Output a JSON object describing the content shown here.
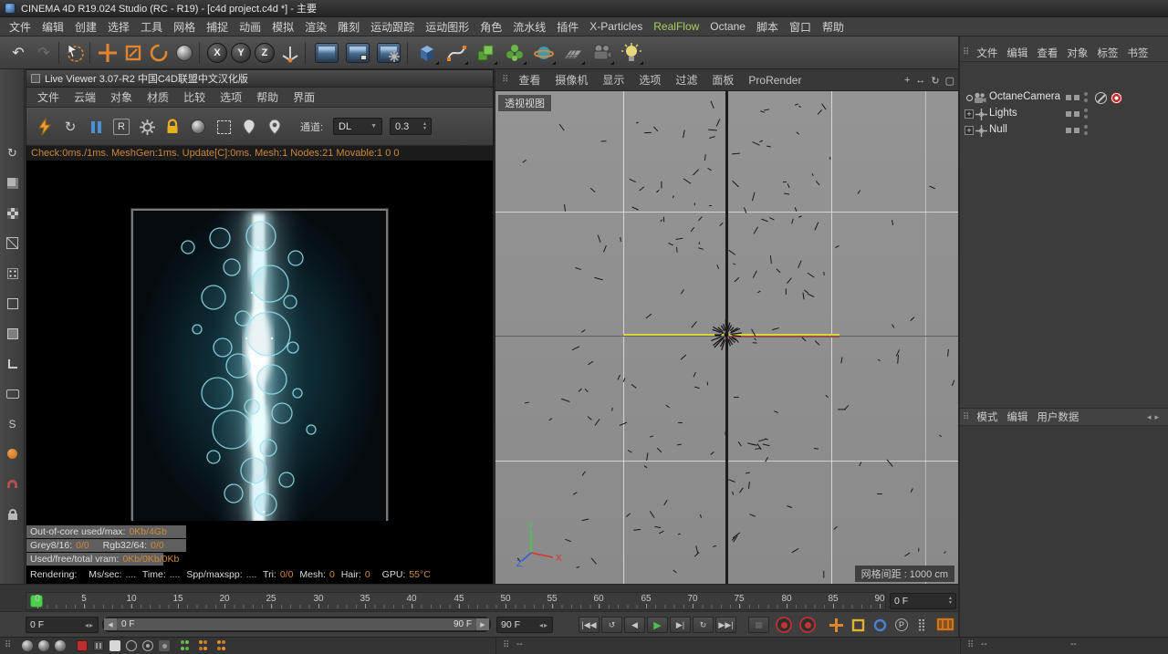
{
  "colors": {
    "accent_orange": "#e2862e",
    "octane_value_orange": "#cf8a3a",
    "realflow_green": "#a8d060",
    "play_green": "#4cc04c",
    "marker_green": "#4cd04c"
  },
  "titlebar": {
    "title": "CINEMA 4D R19.024 Studio (RC - R19) - [c4d project.c4d *] - 主要"
  },
  "menubar": {
    "items": [
      "文件",
      "编辑",
      "创建",
      "选择",
      "工具",
      "网格",
      "捕捉",
      "动画",
      "模拟",
      "渲染",
      "雕刻",
      "运动跟踪",
      "运动图形",
      "角色",
      "流水线",
      "插件",
      "X-Particles",
      "RealFlow",
      "Octane",
      "脚本",
      "窗口",
      "帮助"
    ]
  },
  "toolbar": {
    "axis_x": "X",
    "axis_y": "Y",
    "axis_z": "Z"
  },
  "left_toolbar": {
    "snap_label": "S"
  },
  "live_viewer": {
    "title": "Live Viewer 3.07-R2 中国C4D联盟中文汉化版",
    "menus": [
      "文件",
      "云端",
      "对象",
      "材质",
      "比较",
      "选项",
      "帮助",
      "界面"
    ],
    "r_button": "R",
    "channel_label": "通道:",
    "channel_value": "DL",
    "sample_value": "0.3",
    "status_line": "Check:0ms./1ms. MeshGen:1ms. Update[C]:0ms. Mesh:1 Nodes:21 Movable:1  0 0",
    "stats": {
      "outofcore_label": "Out-of-core used/max:",
      "outofcore_value": "0Kb/4Gb",
      "grey_label": "Grey8/16:",
      "grey_value": "0/0",
      "rgb_label": "Rgb32/64:",
      "rgb_value": "0/0",
      "vram_label": "Used/free/total vram:",
      "vram_value": "0Kb/0Kb/0Kb",
      "rendering_label": "Rendering:",
      "mssec_label": "Ms/sec:",
      "mssec_value": "....",
      "time_label": "Time:",
      "time_value": "....",
      "spp_label": "Spp/maxspp:",
      "spp_value": "....",
      "tri_label": "Tri:",
      "tri_value": "0/0",
      "mesh_label": "Mesh:",
      "mesh_value": "0",
      "hair_label": "Hair:",
      "hair_value": "0",
      "gpu_label": "GPU:",
      "gpu_value": "55°C"
    }
  },
  "viewport": {
    "menus": [
      "查看",
      "摄像机",
      "显示",
      "选项",
      "过滤",
      "面板",
      "ProRender"
    ],
    "view_label": "透视视图",
    "grid_spacing_label": "网格间距 : 1000 cm",
    "axis_x": "X",
    "axis_y": "Y",
    "axis_z": "Z"
  },
  "object_manager": {
    "menus": [
      "文件",
      "编辑",
      "查看",
      "对象",
      "标签",
      "书签"
    ],
    "objects": [
      {
        "label": "OctaneCamera"
      },
      {
        "label": "Lights"
      },
      {
        "label": "Null"
      }
    ]
  },
  "attribute_manager": {
    "menus": [
      "模式",
      "编辑",
      "用户数据"
    ]
  },
  "timeline": {
    "ticks": [
      "0",
      "5",
      "10",
      "15",
      "20",
      "25",
      "30",
      "35",
      "40",
      "45",
      "50",
      "55",
      "60",
      "65",
      "70",
      "75",
      "80",
      "85",
      "90"
    ],
    "frame_field": "0 F",
    "current_frame": "0 F",
    "range_start": "0 F",
    "range_end": "90 F",
    "end_frame": "90 F"
  },
  "playback": {
    "parameter_label": "P"
  },
  "bottom": {
    "mid_value": "--",
    "right_value1": "--",
    "right_value2": "--"
  }
}
